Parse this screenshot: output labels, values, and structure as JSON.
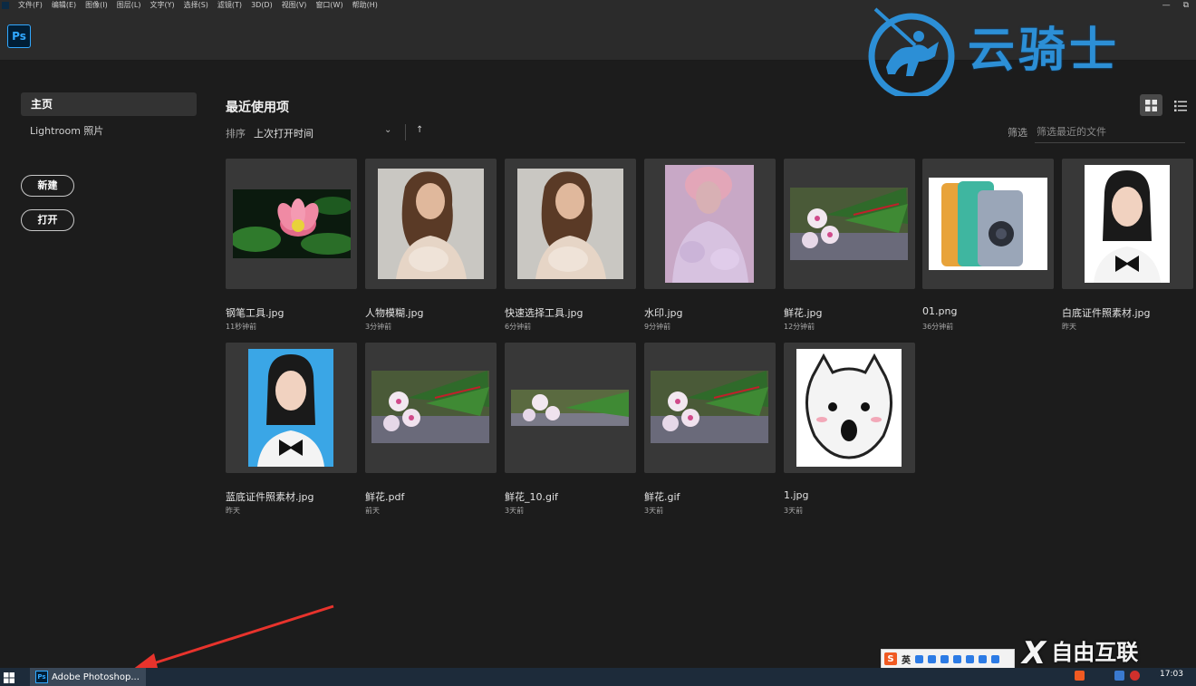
{
  "menu": {
    "items": [
      "文件(F)",
      "编辑(E)",
      "图像(I)",
      "图层(L)",
      "文字(Y)",
      "选择(S)",
      "滤镜(T)",
      "3D(D)",
      "视图(V)",
      "窗口(W)",
      "帮助(H)"
    ],
    "window_buttons": [
      "—",
      "⧉"
    ]
  },
  "header": {
    "logo": "Ps"
  },
  "watermark": {
    "text": "云骑士",
    "bottom_text": "自由互联",
    "bottom_mark": "X"
  },
  "sidebar": {
    "home_label": "主页",
    "lightroom_label": "Lightroom 照片",
    "new_button": "新建",
    "open_button": "打开"
  },
  "main": {
    "title": "最近使用项",
    "sort_label": "排序",
    "sort_value": "上次打开时间",
    "sort_chevron": "⌄",
    "sort_direction": "↑",
    "filter_label": "筛选",
    "filter_placeholder": "筛选最近的文件"
  },
  "files": [
    {
      "name": "钢笔工具.jpg",
      "time": "11秒钟前"
    },
    {
      "name": "人物模糊.jpg",
      "time": "3分钟前"
    },
    {
      "name": "快速选择工具.jpg",
      "time": "6分钟前"
    },
    {
      "name": "水印.jpg",
      "time": "9分钟前"
    },
    {
      "name": "鲜花.jpg",
      "time": "12分钟前"
    },
    {
      "name": "01.png",
      "time": "36分钟前"
    },
    {
      "name": "白底证件照素材.jpg",
      "time": "昨天"
    },
    {
      "name": "蓝底证件照素材.jpg",
      "time": "昨天"
    },
    {
      "name": "鲜花.pdf",
      "time": "前天"
    },
    {
      "name": "鲜花_10.gif",
      "time": "3天前"
    },
    {
      "name": "鲜花.gif",
      "time": "3天前"
    },
    {
      "name": "1.jpg",
      "time": "3天前"
    }
  ],
  "taskbar": {
    "app_label": "Adobe Photoshop...",
    "app_icon_text": "Ps",
    "clock": "17:03",
    "ime_logo": "S",
    "ime_lang": "英"
  },
  "colors": {
    "accent": "#31a8ff",
    "background": "#1c1c1c",
    "card": "#383838",
    "watermark": "#2c8fd6"
  }
}
